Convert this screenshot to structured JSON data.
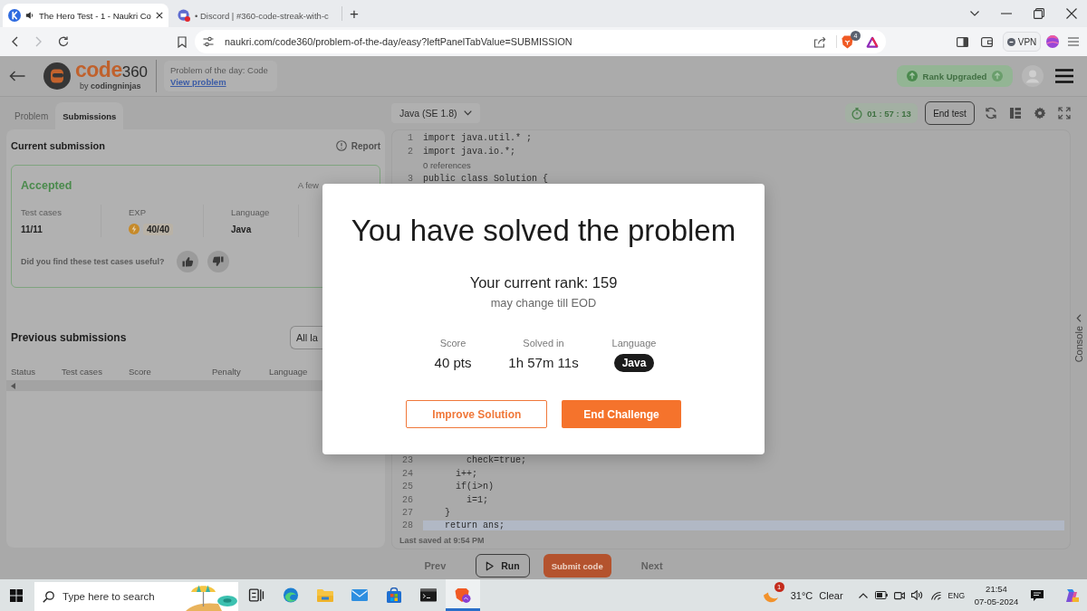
{
  "browser": {
    "tabs": [
      {
        "kind": "site",
        "title": "The Hero Test - 1 - Naukri Co",
        "selected": true,
        "audio": true
      },
      {
        "kind": "chat",
        "title": "• Discord | #360-code-streak-with-c",
        "selected": false,
        "audio": false
      }
    ],
    "new_tab": "+",
    "forward_disabled": true,
    "url": "naukri.com/code360/problem-of-the-day/easy?leftPanelTabValue=SUBMISSION",
    "shield_count": "4",
    "vpn": "VPN"
  },
  "header": {
    "brand": {
      "word": "code",
      "number": "360",
      "tagline": "by **codingninjas**"
    },
    "problem": {
      "title": "Problem of the day: Code",
      "link": "View problem"
    },
    "rank_badge": "Rank Upgraded"
  },
  "left_tabs": [
    {
      "label": "Problem",
      "selected": false
    },
    {
      "label": "Submissions",
      "selected": true
    }
  ],
  "current_submission": {
    "title": "Current submission",
    "report": "Report",
    "status": "Accepted",
    "time": "A few",
    "stats": [
      {
        "label": "Test cases",
        "value": "11/11",
        "kind": "plain"
      },
      {
        "label": "EXP",
        "value": "40/40",
        "kind": "exp"
      },
      {
        "label": "Language",
        "value": "Java",
        "kind": "plain"
      }
    ],
    "feedback": "Did you find these test cases useful?"
  },
  "previous_submissions": {
    "title": "Previous submissions",
    "filter": "All la",
    "columns": [
      "Status",
      "Test cases",
      "Score",
      "Penalty",
      "Language"
    ]
  },
  "editor": {
    "language": "Java (SE 1.8)",
    "timer": "01 : 57 : 13",
    "end_test": "End test",
    "code_top": [
      {
        "kind": "code",
        "number": "1",
        "code": "import java.util.* ;",
        "current": false
      },
      {
        "kind": "code",
        "number": "2",
        "code": "import java.io.*;",
        "current": false
      },
      {
        "kind": "lens",
        "code": "0 references",
        "current": false
      },
      {
        "kind": "code",
        "number": "3",
        "code": "public class Solution {",
        "current": false
      }
    ],
    "code_bottom": [
      {
        "kind": "code",
        "number": "23",
        "code": "        check=true;",
        "current": false
      },
      {
        "kind": "code",
        "number": "24",
        "code": "      i++;",
        "current": false
      },
      {
        "kind": "code",
        "number": "25",
        "code": "      if(i>n)",
        "current": false
      },
      {
        "kind": "code",
        "number": "26",
        "code": "        i=1;",
        "current": false
      },
      {
        "kind": "code",
        "number": "27",
        "code": "    }",
        "current": false
      },
      {
        "kind": "code",
        "number": "28",
        "code": "    return ans;",
        "current": true
      }
    ],
    "last_saved": "Last saved at 9:54 PM",
    "console": "Console"
  },
  "actions": [
    {
      "label": "Prev",
      "kind": "link",
      "disabled": true
    },
    {
      "label": "Run",
      "kind": "run",
      "disabled": false
    },
    {
      "label": "Submit code",
      "kind": "primary",
      "disabled": false
    },
    {
      "label": "Next",
      "kind": "link",
      "disabled": true
    }
  ],
  "modal": {
    "title": "You have solved the problem",
    "rank": "Your current rank: 159",
    "note": "may change till EOD",
    "stats": [
      {
        "label": "Score",
        "value": "40 pts",
        "kind": "text"
      },
      {
        "label": "Solved in",
        "value": "1h 57m 11s",
        "kind": "text"
      },
      {
        "label": "Language",
        "value": "Java",
        "kind": "pill"
      }
    ],
    "buttons": [
      {
        "label": "Improve Solution",
        "kind": "outline"
      },
      {
        "label": "End Challenge",
        "kind": "primary"
      }
    ]
  },
  "taskbar": {
    "search": {
      "placeholder": "Type here to search"
    },
    "apps": [
      {
        "kind": "task_view",
        "active": false
      },
      {
        "kind": "browser",
        "active": false
      },
      {
        "kind": "files",
        "active": false
      },
      {
        "kind": "mail",
        "active": false
      },
      {
        "kind": "store",
        "active": false
      },
      {
        "kind": "terminal",
        "active": false
      },
      {
        "kind": "lion",
        "active": true
      }
    ],
    "weather": {
      "alerts": "1",
      "temperature": "31°C",
      "condition": "Clear"
    },
    "language": "ENG",
    "time": "21:54",
    "date": "07-05-2024"
  }
}
